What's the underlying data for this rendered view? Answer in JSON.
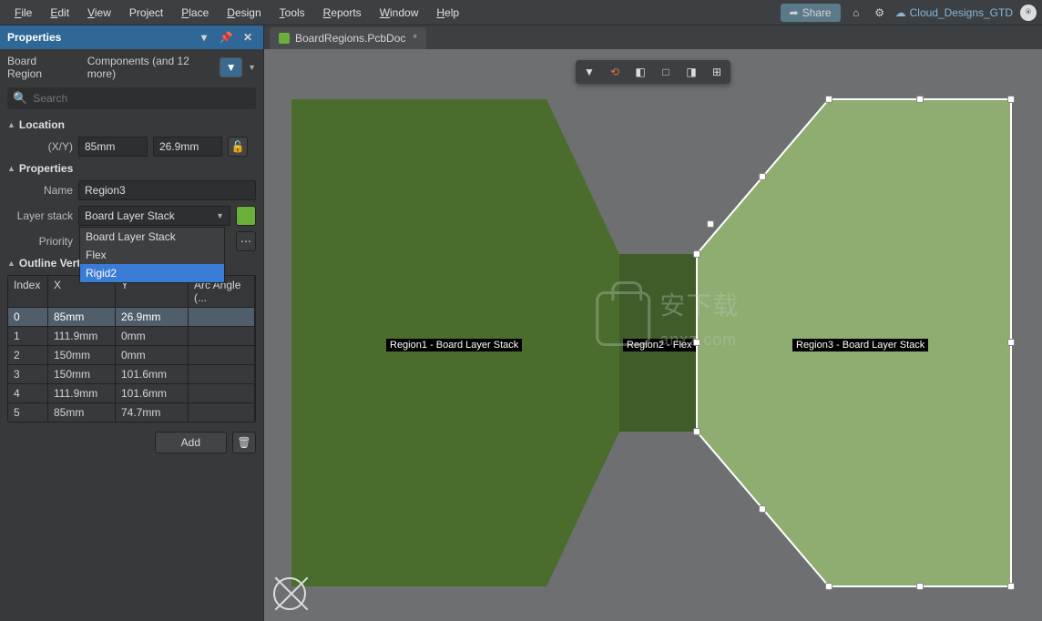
{
  "menu": {
    "items": [
      "File",
      "Edit",
      "View",
      "Project",
      "Place",
      "Design",
      "Tools",
      "Reports",
      "Window",
      "Help"
    ],
    "share": "Share",
    "cloud": "Cloud_Designs_GTD"
  },
  "panel": {
    "title": "Properties",
    "context": "Board Region",
    "components": "Components (and 12 more)",
    "search_placeholder": "Search",
    "location_header": "Location",
    "xy_label": "(X/Y)",
    "x": "85mm",
    "y": "26.9mm",
    "properties_header": "Properties",
    "name_label": "Name",
    "name_value": "Region3",
    "layer_label": "Layer stack",
    "layer_value": "Board Layer Stack",
    "layer_options": [
      "Board Layer Stack",
      "Flex",
      "Rigid2"
    ],
    "priority_label": "Priority",
    "vertices_header": "Outline Vertices",
    "cols": {
      "index": "Index",
      "x": "X",
      "y": "Y",
      "arc": "Arc Angle (..."
    },
    "rows": [
      {
        "i": "0",
        "x": "85mm",
        "y": "26.9mm"
      },
      {
        "i": "1",
        "x": "111.9mm",
        "y": "0mm"
      },
      {
        "i": "2",
        "x": "150mm",
        "y": "0mm"
      },
      {
        "i": "3",
        "x": "150mm",
        "y": "101.6mm"
      },
      {
        "i": "4",
        "x": "111.9mm",
        "y": "101.6mm"
      },
      {
        "i": "5",
        "x": "85mm",
        "y": "74.7mm"
      }
    ],
    "add_btn": "Add"
  },
  "tab": {
    "label": "BoardRegions.PcbDoc",
    "dirty": "*"
  },
  "regions": {
    "r1": "Region1 - Board Layer Stack",
    "r2": "Region2 - Flex",
    "r3": "Region3 - Board Layer Stack"
  },
  "watermark": "安下载\nanxz.com"
}
